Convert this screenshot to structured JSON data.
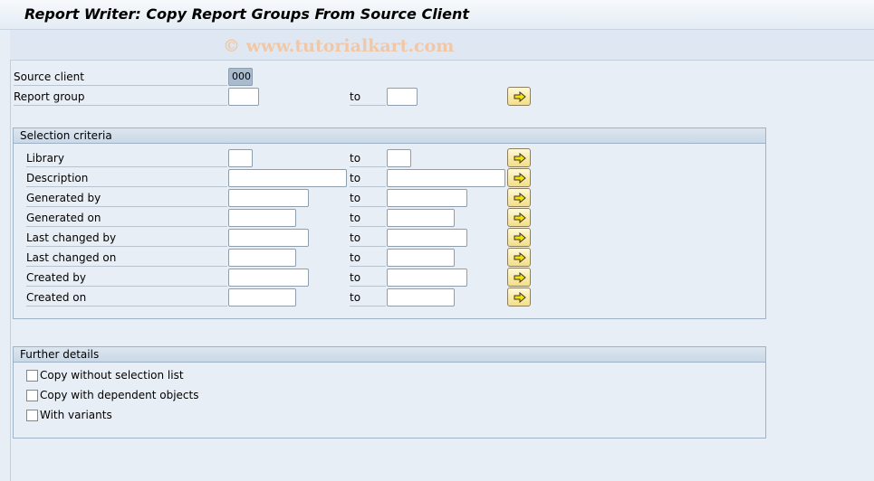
{
  "window": {
    "title": "Report Writer: Copy Report Groups From Source Client",
    "watermark": "© www.tutorialkart.com"
  },
  "header_fields": {
    "source_client": {
      "label": "Source client",
      "value": "000"
    },
    "report_group": {
      "label": "Report group",
      "to_label": "to",
      "from_value": "",
      "to_value": ""
    }
  },
  "selection": {
    "title": "Selection criteria",
    "to_label": "to",
    "rows": [
      {
        "label": "Library",
        "from": "",
        "to": ""
      },
      {
        "label": "Description",
        "from": "",
        "to": ""
      },
      {
        "label": "Generated by",
        "from": "",
        "to": ""
      },
      {
        "label": "Generated on",
        "from": "",
        "to": ""
      },
      {
        "label": "Last changed by",
        "from": "",
        "to": ""
      },
      {
        "label": "Last changed on",
        "from": "",
        "to": ""
      },
      {
        "label": "Created by",
        "from": "",
        "to": ""
      },
      {
        "label": "Created on",
        "from": "",
        "to": ""
      }
    ]
  },
  "further": {
    "title": "Further details",
    "options": [
      {
        "label": "Copy without selection list",
        "checked": false
      },
      {
        "label": "Copy with dependent objects",
        "checked": false
      },
      {
        "label": "With variants",
        "checked": false
      }
    ]
  },
  "icons": {
    "multiple_selection": "arrow-right-icon"
  },
  "colors": {
    "background": "#e8eef5",
    "button_fill": "#f4de86",
    "filled_field": "#a9bccf"
  }
}
